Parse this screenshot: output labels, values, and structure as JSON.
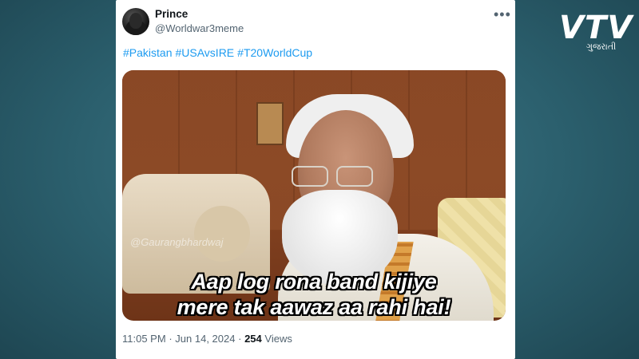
{
  "tweet": {
    "display_name": "Prince",
    "handle": "@Worldwar3meme",
    "more_icon": "more-dots-icon",
    "hashtags": [
      "#Pakistan",
      "#USAvsIRE",
      "#T20WorldCup"
    ],
    "media": {
      "watermark": "@Gaurangbhardwaj",
      "caption_line1": "Aap log rona band kijiye",
      "caption_line2": "mere tak aawaz aa rahi hai!"
    },
    "time": "11:05 PM",
    "sep1": "·",
    "date": "Jun 14, 2024",
    "sep2": "·",
    "views_count": "254",
    "views_label": "Views"
  },
  "brand": {
    "logo_text": "VTV",
    "logo_subtext": "ગુજરાતી"
  },
  "colors": {
    "link": "#1d9bf0",
    "muted": "#536471",
    "text": "#0f1419",
    "background": "#2b5f6d"
  }
}
